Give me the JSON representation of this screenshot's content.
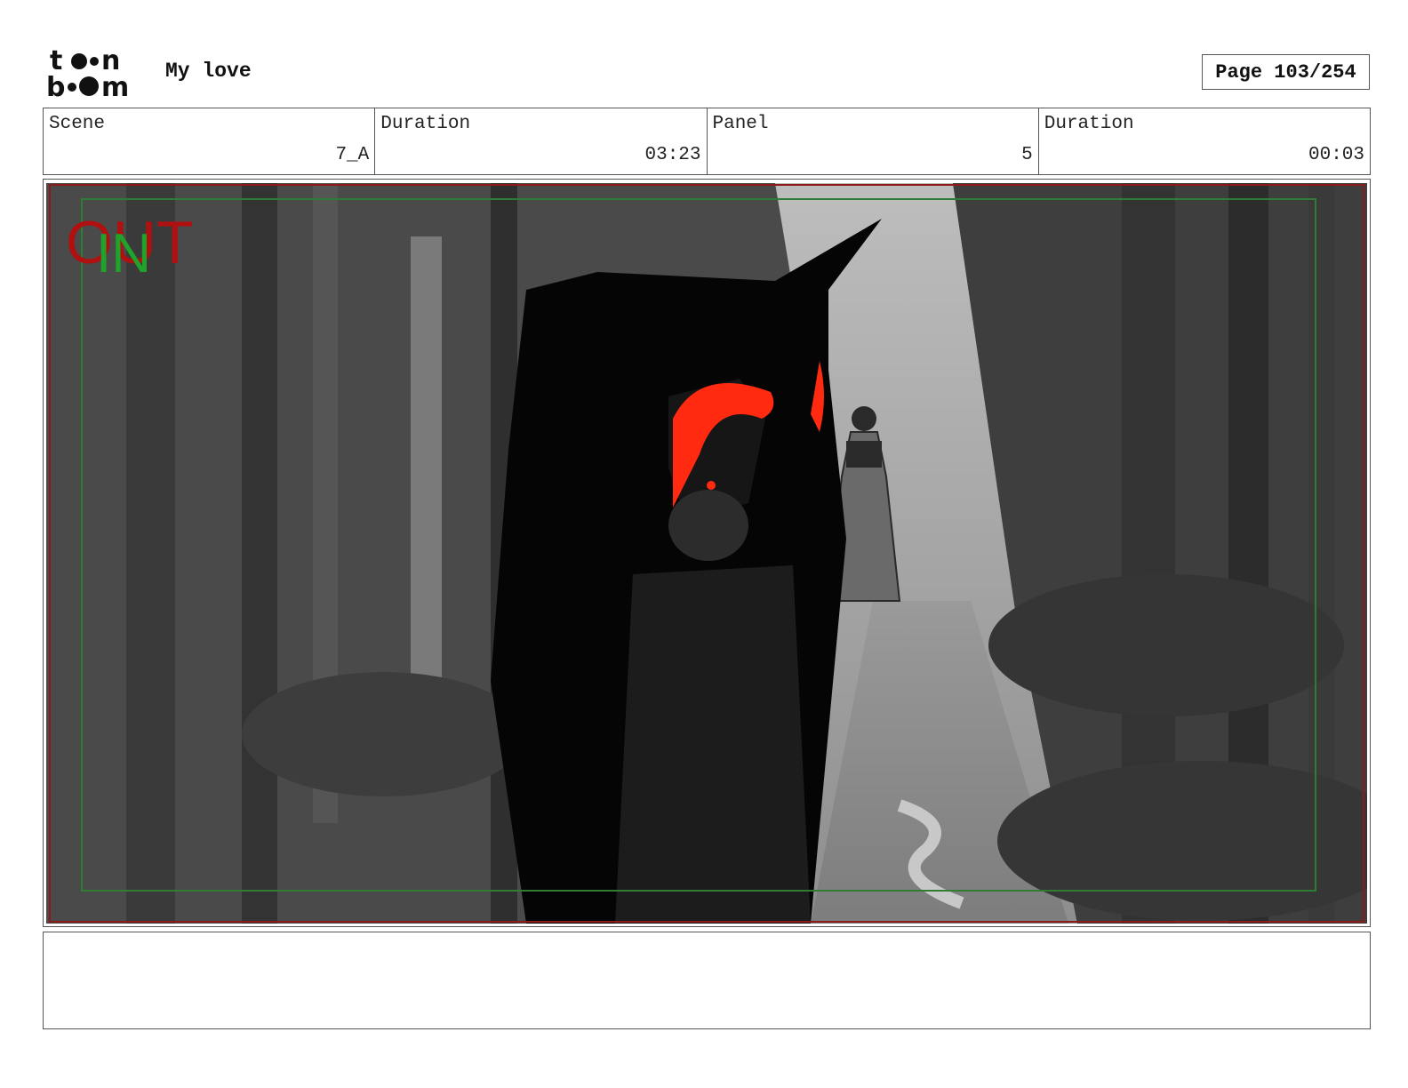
{
  "header": {
    "logo": {
      "line1": "toon",
      "line2": "boom"
    },
    "project_title": "My love",
    "page_label": "Page 103/254"
  },
  "info": {
    "scene_label": "Scene",
    "scene_value": "7_A",
    "scene_duration_label": "Duration",
    "scene_duration_value": "03:23",
    "panel_label": "Panel",
    "panel_value": "5",
    "panel_duration_label": "Duration",
    "panel_duration_value": "00:03"
  },
  "panel": {
    "overlay_out": "OUT",
    "overlay_in": "IN",
    "colors": {
      "out": "#b01010",
      "in": "#1fa32a",
      "eyes": "#ff2a10",
      "frame_outer": "#8b1a1a",
      "frame_safe": "#2e7d32"
    }
  },
  "notes": {
    "text": ""
  }
}
